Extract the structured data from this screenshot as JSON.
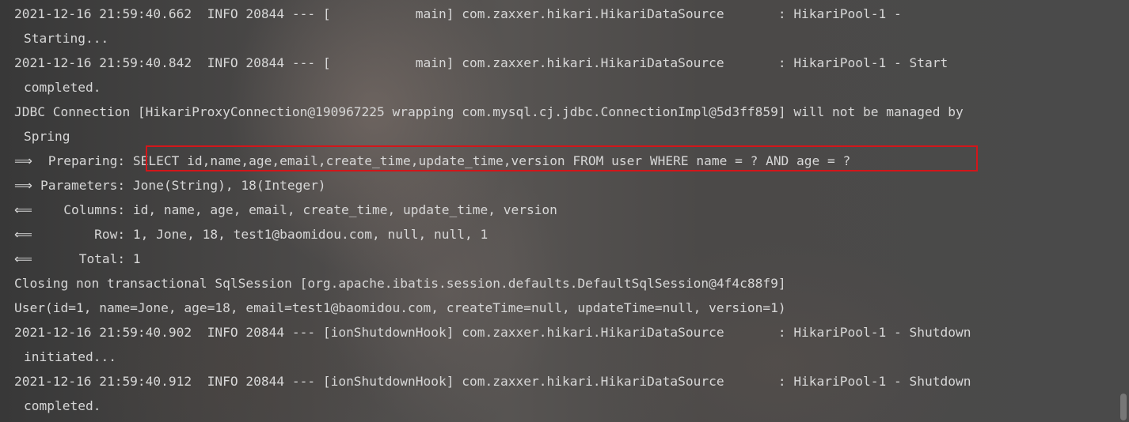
{
  "console": {
    "lines": [
      "2021-12-16 21:59:40.662  INFO 20844 --- [           main] com.zaxxer.hikari.HikariDataSource       : HikariPool-1 -",
      "Starting...",
      "2021-12-16 21:59:40.842  INFO 20844 --- [           main] com.zaxxer.hikari.HikariDataSource       : HikariPool-1 - Start",
      "completed.",
      "JDBC Connection [HikariProxyConnection@190967225 wrapping com.mysql.cj.jdbc.ConnectionImpl@5d3ff859] will not be managed by",
      "Spring",
      "==>  Preparing: SELECT id,name,age,email,create_time,update_time,version FROM user WHERE name = ? AND age = ?",
      "==> Parameters: Jone(String), 18(Integer)",
      "<==    Columns: id, name, age, email, create_time, update_time, version",
      "<==        Row: 1, Jone, 18, test1@baomidou.com, null, null, 1",
      "<==      Total: 1",
      "Closing non transactional SqlSession [org.apache.ibatis.session.defaults.DefaultSqlSession@4f4c88f9]",
      "User(id=1, name=Jone, age=18, email=test1@baomidou.com, createTime=null, updateTime=null, version=1)",
      "2021-12-16 21:59:40.902  INFO 20844 --- [ionShutdownHook] com.zaxxer.hikari.HikariDataSource       : HikariPool-1 - Shutdown",
      "initiated...",
      "2021-12-16 21:59:40.912  INFO 20844 --- [ionShutdownHook] com.zaxxer.hikari.HikariDataSource       : HikariPool-1 - Shutdown",
      "completed."
    ],
    "arrow_out": "⟹",
    "arrow_in": "⟸",
    "preparing_label": "  Preparing: ",
    "preparing_sql": "SELECT id,name,age,email,create_time,update_time,version FROM user WHERE name = ? AND age = ?",
    "parameters_text": " Parameters: Jone(String), 18(Integer)",
    "columns_text": "    Columns: id, name, age, email, create_time, update_time, version",
    "row_text": "        Row: 1, Jone, 18, test1@baomidou.com, null, null, 1",
    "total_text": "      Total: 1",
    "highlight_color": "#d3161a",
    "text_color": "#d7d7d7"
  }
}
